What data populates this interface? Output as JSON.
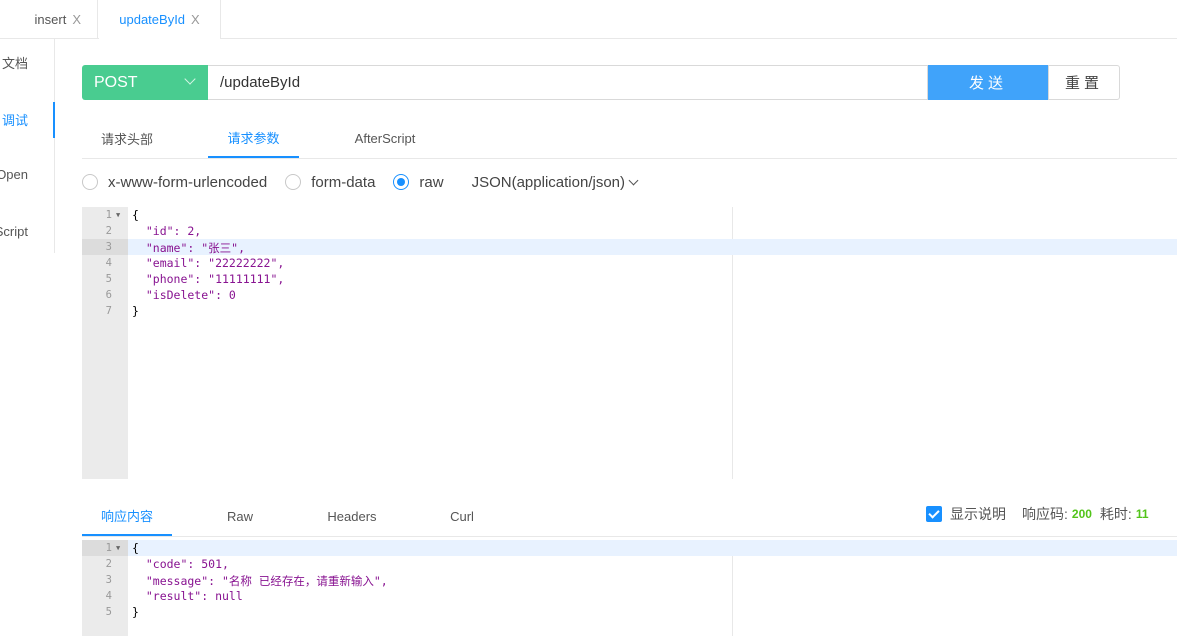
{
  "tabs": [
    {
      "label": "insert",
      "close": "X"
    },
    {
      "label": "updateById",
      "close": "X"
    }
  ],
  "nav": [
    "文档",
    "调试",
    "Open",
    "Script"
  ],
  "request": {
    "method": "POST",
    "url": "/updateById",
    "send_label": "发送",
    "reset_label": "重置"
  },
  "sub_tabs": [
    "请求头部",
    "请求参数",
    "AfterScript"
  ],
  "body_types": [
    "x-www-form-urlencoded",
    "form-data",
    "raw"
  ],
  "selected_body_type": "raw",
  "content_type": "JSON(application/json)",
  "request_body": {
    "line_numbers": [
      "1",
      "2",
      "3",
      "4",
      "5",
      "6",
      "7"
    ],
    "lines": [
      "{",
      "  \"id\": 2,",
      "  \"name\": \"张三\",",
      "  \"email\": \"22222222\",",
      "  \"phone\": \"11111111\",",
      "  \"isDelete\": 0",
      "}"
    ]
  },
  "response_tabs": [
    "响应内容",
    "Raw",
    "Headers",
    "Curl"
  ],
  "response_status": {
    "show_desc_label": "显示说明",
    "show_desc_checked": true,
    "code_label": "响应码:",
    "code_value": "200",
    "time_label": "耗时:",
    "time_value": "11"
  },
  "response_body": {
    "line_numbers": [
      "1",
      "2",
      "3",
      "4",
      "5"
    ],
    "lines": [
      "{",
      "  \"code\": 501,",
      "  \"message\": \"名称 已经存在，请重新输入\",",
      "  \"result\": null",
      "}"
    ]
  },
  "colors": {
    "accent": "#1890ff",
    "method_post": "#49cc90",
    "send": "#40a3fa",
    "success": "#52c41a"
  }
}
